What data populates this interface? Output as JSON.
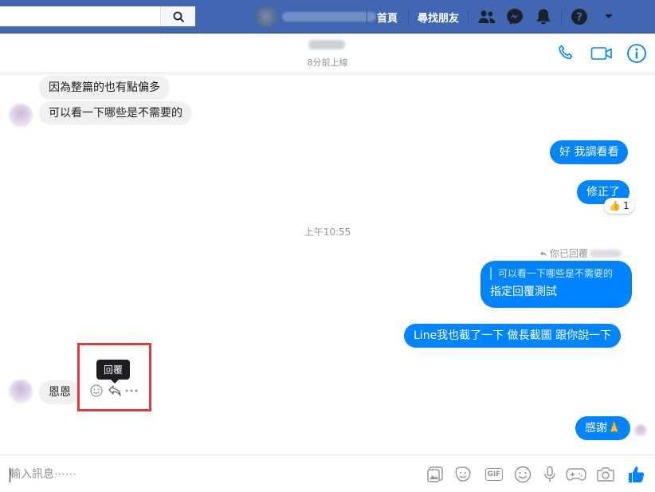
{
  "topbar": {
    "search_placeholder": "",
    "home_label": "首頁",
    "find_friends_label": "尋找朋友"
  },
  "chat": {
    "last_seen": "8分前上線",
    "messages_in_top": [
      "因為整篇的也有點偏多",
      "可以看一下哪些是不需要的"
    ],
    "messages_out": [
      "好 我調看看",
      "修正了",
      "Line我也截了一下 做長截圖 跟你說一下",
      "感謝🙏"
    ],
    "reaction": {
      "emoji": "👍",
      "count": "1"
    },
    "timestamp": "上午10:55",
    "reply_note": "你已回覆",
    "quoted_text": "可以看一下哪些是不需要的",
    "reply_text": "指定回覆測試",
    "message_in_bottom": "恩恩",
    "tooltip": "回覆"
  },
  "composer": {
    "placeholder": "輸入訊息⋯⋯",
    "gif_label": "GIF"
  },
  "colors": {
    "brand": "#4267b2",
    "outgoing_bubble": "#0084ff",
    "incoming_bubble": "#f1f0f0",
    "highlight": "#e03c3c"
  },
  "icons": [
    "search-icon",
    "friends-icon",
    "messenger-icon",
    "bell-icon",
    "help-icon",
    "dropdown-icon",
    "phone-icon",
    "video-icon",
    "info-icon",
    "emoji-icon",
    "reply-icon",
    "more-icon",
    "gallery-icon",
    "sticker-icon",
    "gif-icon",
    "smile-icon",
    "mic-icon",
    "game-icon",
    "camera-icon",
    "thumbs-up-icon"
  ]
}
